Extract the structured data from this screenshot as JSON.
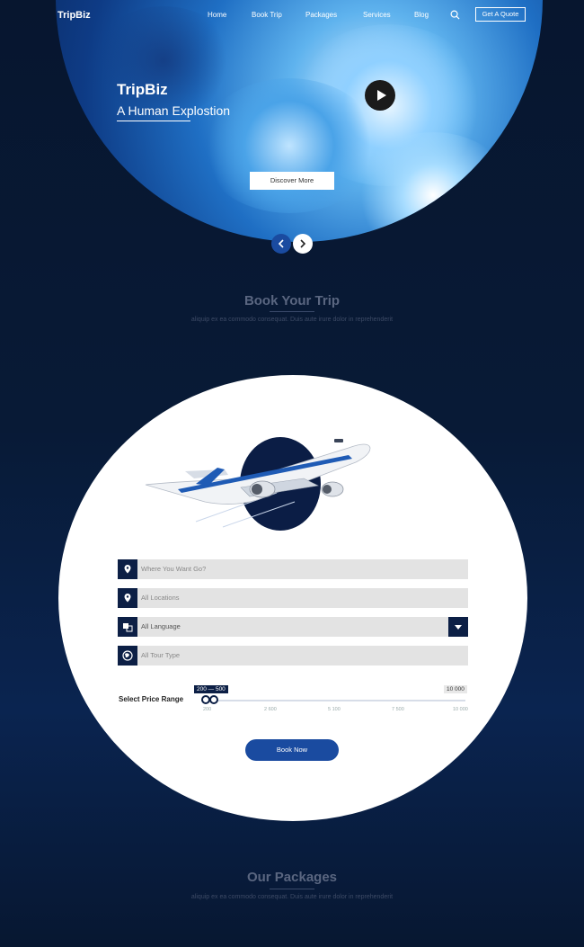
{
  "header": {
    "logo": "TripBiz",
    "nav": [
      "Home",
      "Book Trip",
      "Packages",
      "Services",
      "Blog"
    ],
    "quote_button": "Get A Quote"
  },
  "hero": {
    "title": "TripBiz",
    "subtitle": "A Human Explostion",
    "discover_button": "Discover More"
  },
  "book_section": {
    "title": "Book Your Trip",
    "description": "aliquip ex ea commodo consequat. Duis aute irure dolor in reprehenderit"
  },
  "booking_form": {
    "destination_placeholder": "Where You Want Go?",
    "location_placeholder": "All Locations",
    "language_value": "All Language",
    "tour_type_placeholder": "All Tour Type",
    "price_label": "Select Price Range",
    "range_selected": "200 — 500",
    "range_max_label": "10 000",
    "range_ticks": [
      "200",
      "2 600",
      "5 100",
      "7 500",
      "10 000"
    ],
    "book_button": "Book Now"
  },
  "packages_section": {
    "title": "Our Packages",
    "description": "aliquip ex ea commodo consequat. Duis aute irure dolor in reprehenderit"
  },
  "colors": {
    "background": "#07162f",
    "accent": "#1a4ba0",
    "dark_navy": "#0c1f45"
  }
}
